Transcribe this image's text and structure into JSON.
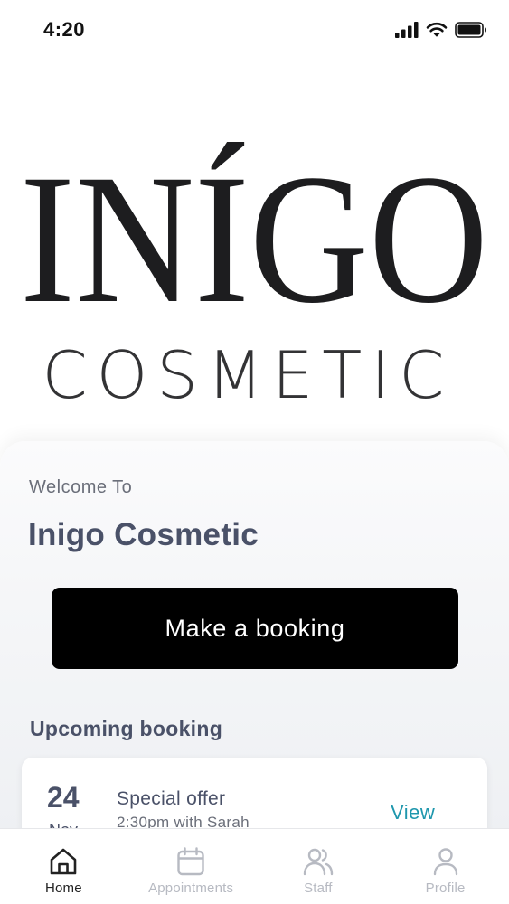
{
  "status_bar": {
    "time": "4:20",
    "icons": [
      "signal-icon",
      "wifi-icon",
      "battery-icon"
    ]
  },
  "logo": {
    "wordmark": "INÍGO",
    "subtitle": "COSMETIC"
  },
  "welcome": {
    "greeting": "Welcome To",
    "business_name": "Inigo Cosmetic"
  },
  "actions": {
    "booking_button": "Make a booking"
  },
  "upcoming": {
    "section_title": "Upcoming booking",
    "booking": {
      "day": "24",
      "month": "Nov",
      "title": "Special offer",
      "details": "2:30pm with Sarah",
      "action": "View"
    }
  },
  "tabbar": {
    "tabs": [
      {
        "label": "Home",
        "icon": "home-icon",
        "active": true
      },
      {
        "label": "Appointments",
        "icon": "calendar-icon",
        "active": false
      },
      {
        "label": "Staff",
        "icon": "users-icon",
        "active": false
      },
      {
        "label": "Profile",
        "icon": "user-icon",
        "active": false
      }
    ]
  },
  "colors": {
    "accent": "#1f97ad",
    "heading": "#4a5168",
    "button_bg": "#000000",
    "tab_inactive": "#b7bac2"
  }
}
